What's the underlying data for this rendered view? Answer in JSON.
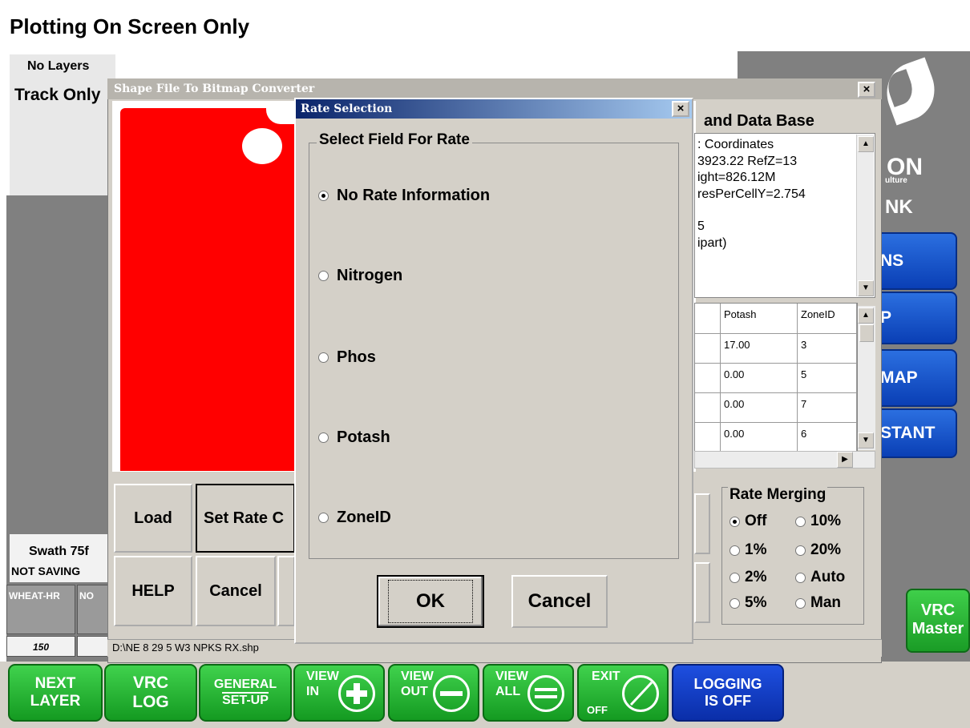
{
  "app": {
    "title": "Plotting On Screen Only",
    "layers_label": "No Layers",
    "track_label": "Track Only",
    "swath_label": "Swath 75f",
    "saving_label": "NOT SAVING",
    "product_1": "WHEAT-HR",
    "product_2": "NO",
    "rate_1": "150",
    "logo_frag_1": "ON",
    "logo_frag_2": "ulture",
    "logo_frag_3": "NK",
    "side_buttons": [
      "NS",
      "P",
      "MAP",
      "STANT"
    ],
    "vrc_master_l1": "VRC",
    "vrc_master_l2": "Master"
  },
  "toolbar": {
    "next_layer_l1": "NEXT",
    "next_layer_l2": "LAYER",
    "vrc_log_l1": "VRC",
    "vrc_log_l2": "LOG",
    "general_l1": "GENERAL",
    "general_l2": "SET-UP",
    "view_in_word": "VIEW",
    "view_in_sub": "IN",
    "view_out_word": "VIEW",
    "view_out_sub": "OUT",
    "view_all_word": "VIEW",
    "view_all_sub": "ALL",
    "exit_word": "EXIT",
    "exit_sub": "OFF",
    "logging_l1": "LOGGING",
    "logging_l2": "IS OFF"
  },
  "converter": {
    "title": "Shape File To Bitmap Converter",
    "close": "×",
    "load": "Load",
    "set_rate": "Set Rate C",
    "help": "HELP",
    "cancel": "Cancel",
    "path": "D:\\NE 8 29 5 W3 NPKS RX.shp",
    "db_header": "and Data Base",
    "db_lines": [
      ": Coordinates",
      "3923.22 RefZ=13",
      "ight=826.12M",
      "resPerCellY=2.754",
      "",
      "5",
      "ipart)"
    ],
    "grid_headers": [
      "",
      "Potash",
      "ZoneID"
    ],
    "grid_rows": [
      [
        "",
        "17.00",
        "3"
      ],
      [
        "",
        "0.00",
        "5"
      ],
      [
        "",
        "0.00",
        "7"
      ],
      [
        "",
        "0.00",
        "6"
      ]
    ],
    "merge_title": "Rate Merging",
    "merge_options": [
      {
        "label": "Off",
        "selected": true
      },
      {
        "label": "10%",
        "selected": false
      },
      {
        "label": "1%",
        "selected": false
      },
      {
        "label": "20%",
        "selected": false
      },
      {
        "label": "2%",
        "selected": false
      },
      {
        "label": "Auto",
        "selected": false
      },
      {
        "label": "5%",
        "selected": false
      },
      {
        "label": "Man",
        "selected": false
      }
    ]
  },
  "rate_dialog": {
    "title": "Rate Selection",
    "close": "×",
    "group_label": "Select Field For Rate",
    "options": [
      {
        "label": "No Rate Information",
        "selected": true
      },
      {
        "label": "Nitrogen",
        "selected": false
      },
      {
        "label": "Phos",
        "selected": false
      },
      {
        "label": "Potash",
        "selected": false
      },
      {
        "label": "ZoneID",
        "selected": false
      }
    ],
    "ok": "OK",
    "cancel": "Cancel"
  },
  "colors": {
    "field": "#ff0000",
    "button_green": "#1fae2c",
    "button_blue": "#0a3fb5"
  }
}
